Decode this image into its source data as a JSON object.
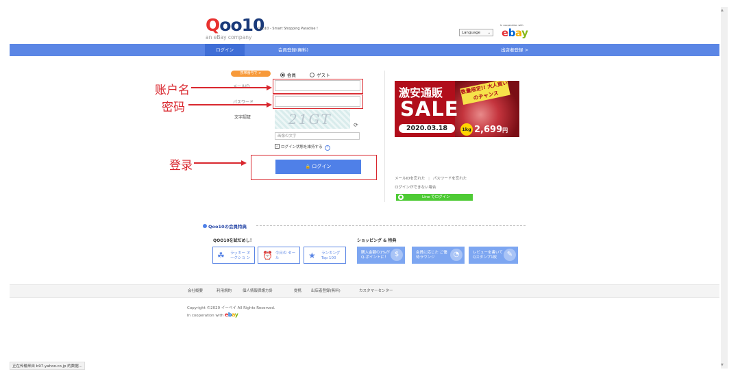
{
  "header": {
    "logo_main": "Qoo10",
    "logo_sub": "an eBay company",
    "tagline": "Qoo10 - Smart Shopping Paradise !",
    "language_select": "Language",
    "coop_small": "In cooperation with",
    "ebay_letters": [
      "e",
      "b",
      "a",
      "y"
    ]
  },
  "nav": {
    "login": "ログイン",
    "register": "会員登録(無料)",
    "seller": "出店者登録 >"
  },
  "login": {
    "badge": "携帯番号で >",
    "radio_member": "会員",
    "radio_guest": "ゲスト",
    "id_placeholder": "メールID",
    "password_label": "パスワード",
    "captcha_label": "文字認証",
    "captcha_code": "21GT",
    "captcha_input_placeholder": "画像の文字",
    "keep_login": "ログイン状態を維持する",
    "help": "?",
    "login_button": "ログイン",
    "lock_icon": "🔒"
  },
  "annotations": {
    "account": "账户名",
    "password": "密码",
    "login": "登录"
  },
  "banner": {
    "title": "激安通販",
    "sale": "SALE",
    "date": "2020.03.18",
    "tag": "数量限定!! 大人買いのチャンス",
    "kg": "1kg",
    "price": "2,699",
    "yen": "円"
  },
  "side_links": {
    "forgot_id": "メールIDを忘れた",
    "forgot_password": "パスワードを忘れた",
    "cannot_login": "ログインができない場合",
    "line_login": "Line でログイン"
  },
  "benefits": {
    "title": "Qoo10の会員特典",
    "try_heading": "QOO10を試だめし！",
    "shopping_heading": "ショッピング & 特典",
    "try_items": [
      {
        "icon": "☘",
        "label": "ラッキー オークショ ン"
      },
      {
        "icon": "⏰",
        "label": "今日の セール"
      },
      {
        "icon": "★",
        "label": "ランキング Top 100"
      }
    ],
    "shop_items": [
      {
        "label": "購入金額の1%が Q-ポイントに！",
        "deco": "$"
      },
      {
        "label": "会員に応じた ご優待ラウンジ",
        "deco": "◔"
      },
      {
        "label": "レビューを書いて Qスタンプ1枚",
        "deco": "✎"
      }
    ]
  },
  "footer": {
    "links": [
      "会社概要",
      "利用規約",
      "個人情報保護方針",
      "提携",
      "出店者登録(無料)",
      "カスタマーセンター"
    ],
    "copyright": "Copyright ©2020 イーベイ All Rights Reserved.",
    "coop": "In cooperation with"
  },
  "status_bar": "正在传输来自 b97.yahoo.co.jp 的数据..."
}
